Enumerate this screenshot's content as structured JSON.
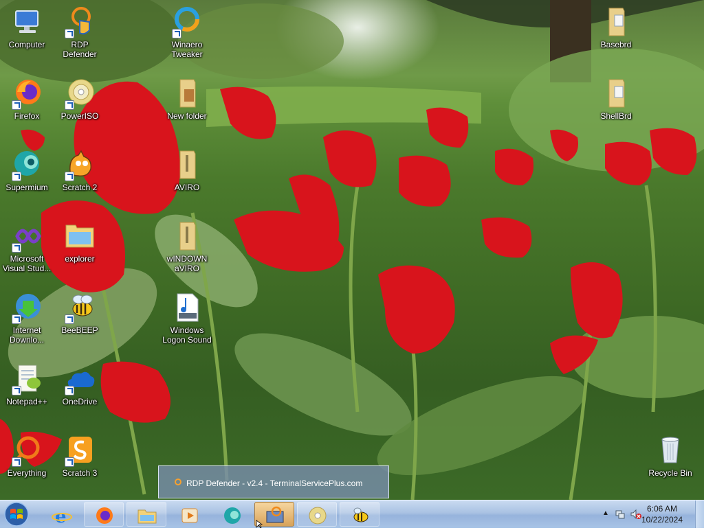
{
  "desktop": {
    "icons": [
      {
        "label": "Computer",
        "icon": "computer-icon"
      },
      {
        "label": "RDP Defender",
        "icon": "rdp-defender-icon"
      },
      {
        "label": "Winaero Tweaker",
        "icon": "winaero-icon"
      },
      {
        "label": "Basebrd",
        "icon": "folder-icon"
      },
      {
        "label": "Firefox",
        "icon": "firefox-icon"
      },
      {
        "label": "PowerISO",
        "icon": "poweriso-icon"
      },
      {
        "label": "New folder",
        "icon": "folder-icon"
      },
      {
        "label": "ShellBrd",
        "icon": "folder-icon"
      },
      {
        "label": "Supermium",
        "icon": "supermium-icon"
      },
      {
        "label": "Scratch 2",
        "icon": "scratch2-icon"
      },
      {
        "label": "AVIRO",
        "icon": "zip-folder-icon"
      },
      {
        "label": "Microsoft Visual Stud...",
        "icon": "visual-studio-icon"
      },
      {
        "label": "explorer",
        "icon": "explorer-icon"
      },
      {
        "label": "wINDOWN aVIRO",
        "icon": "zip-folder-icon"
      },
      {
        "label": "Internet Downlo...",
        "icon": "idm-icon"
      },
      {
        "label": "BeeBEEP",
        "icon": "beebeep-icon"
      },
      {
        "label": "Windows Logon Sound",
        "icon": "wav-file-icon"
      },
      {
        "label": "Notepad++",
        "icon": "notepadpp-icon"
      },
      {
        "label": "OneDrive",
        "icon": "onedrive-icon"
      },
      {
        "label": "Everything",
        "icon": "everything-icon"
      },
      {
        "label": "Scratch 3",
        "icon": "scratch3-icon"
      },
      {
        "label": "Recycle Bin",
        "icon": "recycle-bin-icon"
      }
    ]
  },
  "taskbar": {
    "items": [
      {
        "name": "internet-explorer",
        "icon": "ie-icon"
      },
      {
        "name": "firefox",
        "icon": "firefox-icon"
      },
      {
        "name": "file-explorer",
        "icon": "folder-icon"
      },
      {
        "name": "media-player",
        "icon": "media-player-icon"
      },
      {
        "name": "supermium",
        "icon": "supermium-icon"
      },
      {
        "name": "rdp-defender",
        "icon": "rdp-defender-icon"
      },
      {
        "name": "poweriso",
        "icon": "poweriso-icon"
      },
      {
        "name": "beebeep",
        "icon": "beebeep-icon"
      }
    ],
    "tooltip": "RDP Defender - v2.4 - TerminalServicePlus.com",
    "clock": {
      "time": "6:06 AM",
      "date": "10/22/2024"
    }
  }
}
